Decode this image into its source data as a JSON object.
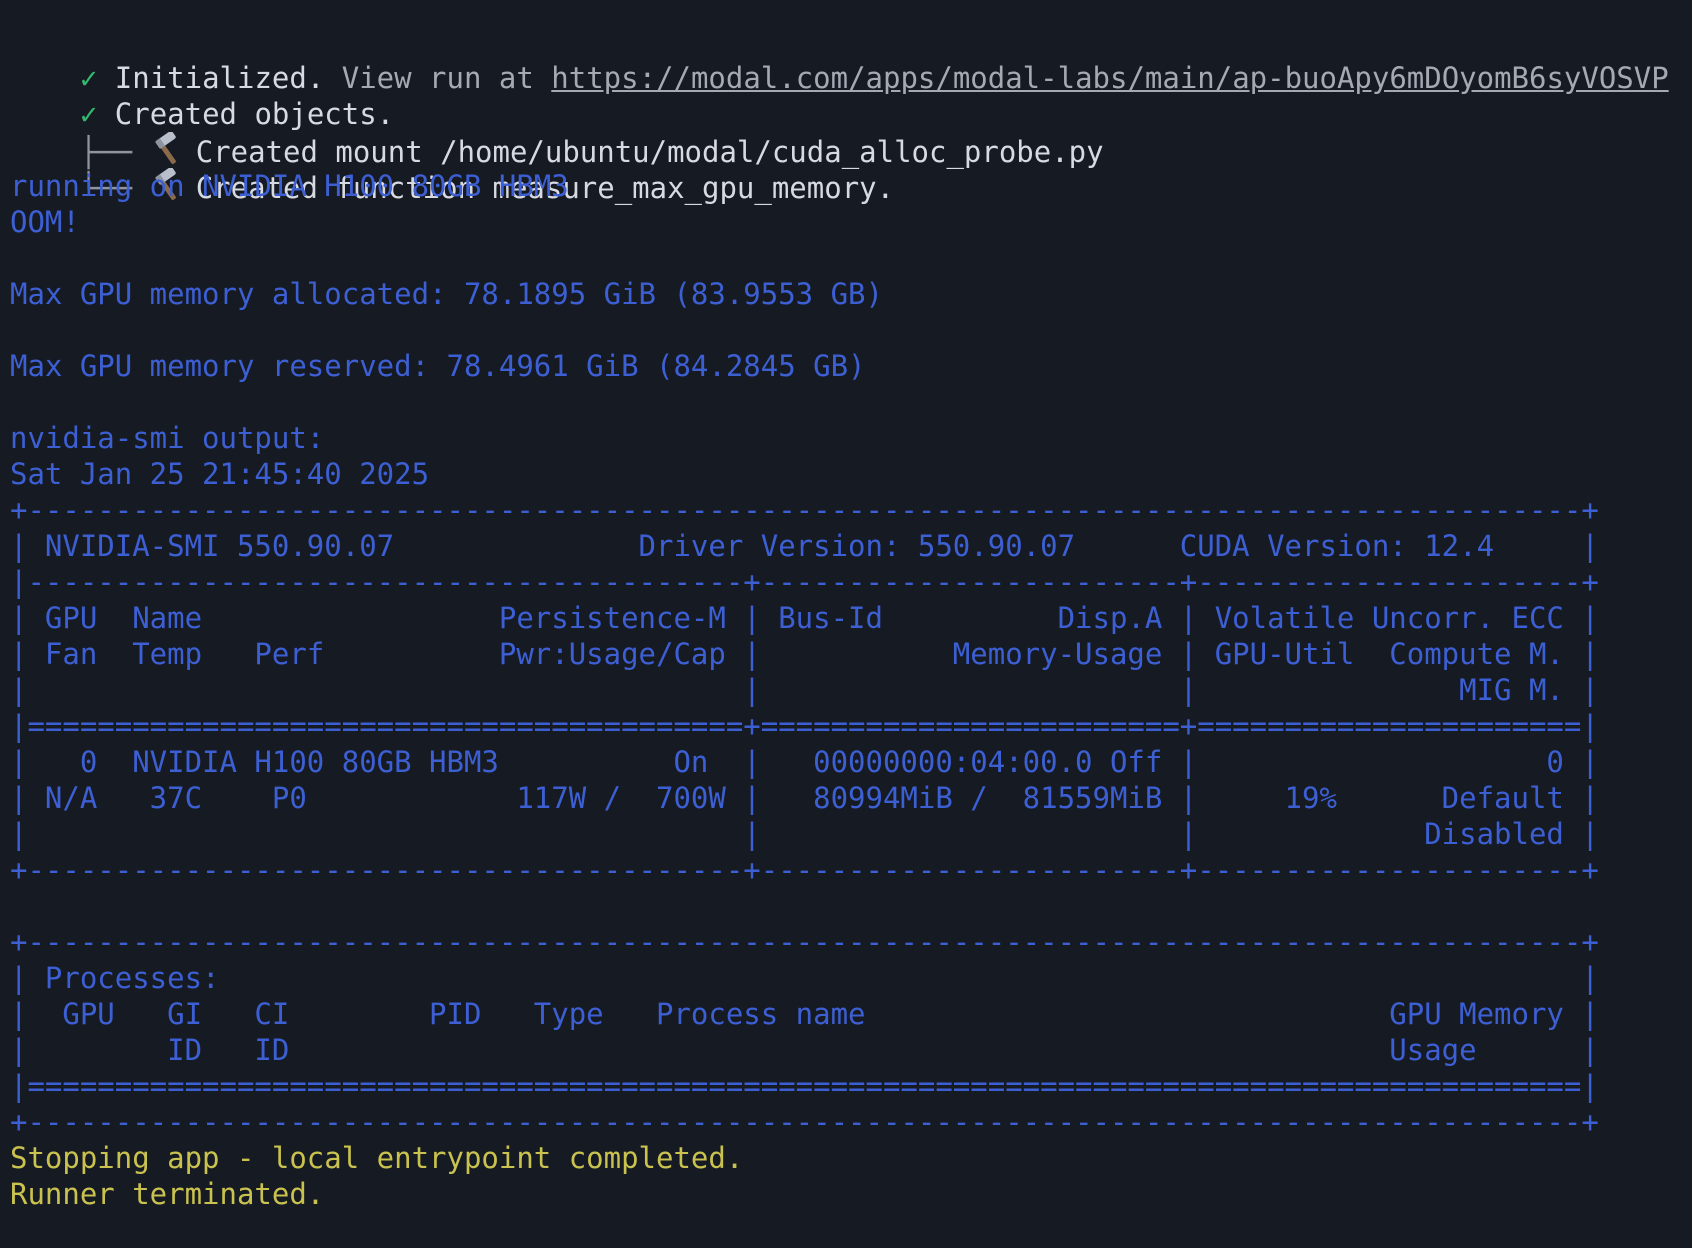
{
  "header": {
    "clipped_line": "                                                                                                    ",
    "init": {
      "check": "✓",
      "text": " Initialized.",
      "view_text": " View run at ",
      "url": "https://modal.com/apps/modal-labs/main/ap-buoApy6mDOyomB6syVOSVP"
    },
    "created": {
      "check": "✓",
      "text": " Created objects."
    },
    "mount": {
      "tree": "├── ",
      "text": "Created mount /home/ubuntu/modal/cuda_alloc_probe.py"
    },
    "function": {
      "tree": "└── ",
      "text": "Created function measure_max_gpu_memory."
    }
  },
  "output": {
    "running": "running on NVIDIA H100 80GB HBM3",
    "oom": "OOM!",
    "blank1": "",
    "allocated": "Max GPU memory allocated: 78.1895 GiB (83.9553 GB)",
    "blank2": "",
    "reserved": "Max GPU memory reserved: 78.4961 GiB (84.2845 GB)",
    "blank3": "",
    "smi_label": "nvidia-smi output:",
    "timestamp": "Sat Jan 25 21:45:40 2025"
  },
  "smi_table": {
    "lines": [
      "+-----------------------------------------------------------------------------------------+",
      "| NVIDIA-SMI 550.90.07              Driver Version: 550.90.07      CUDA Version: 12.4     |",
      "|-----------------------------------------+------------------------+----------------------+",
      "| GPU  Name                 Persistence-M | Bus-Id          Disp.A | Volatile Uncorr. ECC |",
      "| Fan  Temp   Perf          Pwr:Usage/Cap |           Memory-Usage | GPU-Util  Compute M. |",
      "|                                         |                        |               MIG M. |",
      "|=========================================+========================+======================|",
      "|   0  NVIDIA H100 80GB HBM3          On  |   00000000:04:00.0 Off |                    0 |",
      "| N/A   37C    P0            117W /  700W |   80994MiB /  81559MiB |     19%      Default |",
      "|                                         |                        |             Disabled |",
      "+-----------------------------------------+------------------------+----------------------+",
      "",
      "+-----------------------------------------------------------------------------------------+",
      "| Processes:                                                                              |",
      "|  GPU   GI   CI        PID   Type   Process name                              GPU Memory |",
      "|        ID   ID                                                               Usage      |",
      "|=========================================================================================|",
      "+-----------------------------------------------------------------------------------------+"
    ]
  },
  "footer": {
    "stopping": "Stopping app - local entrypoint completed.",
    "terminated": "Runner terminated.",
    "clipped_bottom": "                                                                                          "
  },
  "icons": {
    "check": "check-icon",
    "hammer": "hammer-icon"
  },
  "colors": {
    "background": "#161a22",
    "text": "#d7dae0",
    "success": "#35b86d",
    "output": "#3d5fd4",
    "status": "#c9c24f"
  }
}
